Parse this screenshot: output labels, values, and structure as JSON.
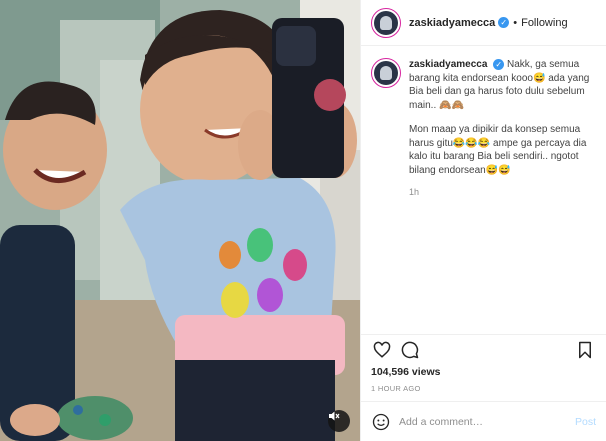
{
  "post": {
    "author": "zaskiadyamecca",
    "following_label": "Following",
    "caption_p1": "Nakk, ga semua barang kita endorsean kooo😅 ada yang Bia beli dan ga harus foto dulu sebelum main.. 🙈🙈",
    "caption_p2": "Mon maap ya dipikir da konsep semua harus gitu😂😂😂 ampe ga percaya dia kalo itu barang Bia beli sendiri.. ngotot bilang endorsean😅😅",
    "caption_time": "1h",
    "views": "104,596 views",
    "posted_ago": "1 HOUR AGO",
    "comment_placeholder": "Add a comment…",
    "post_label": "Post"
  },
  "icons": {
    "verified": "verified-badge-icon",
    "like": "heart-icon",
    "comment": "comment-bubble-icon",
    "save": "bookmark-icon",
    "mute": "speaker-muted-icon",
    "emoji": "smiley-icon"
  },
  "colors": {
    "verified": "#3897f0",
    "post_disabled": "#b3dbff",
    "story_ring": "#d6249f"
  }
}
